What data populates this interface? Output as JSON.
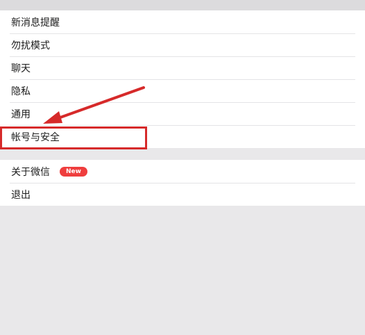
{
  "settings": {
    "group1": [
      {
        "label": "新消息提醒"
      },
      {
        "label": "勿扰模式"
      },
      {
        "label": "聊天"
      },
      {
        "label": "隐私"
      },
      {
        "label": "通用"
      },
      {
        "label": "帐号与安全"
      }
    ],
    "group2": [
      {
        "label": "关于微信",
        "badge": "New"
      },
      {
        "label": "退出"
      }
    ]
  },
  "colors": {
    "background": "#e9e8ea",
    "annotation": "#d62a2a",
    "badge": "#ef3e3e"
  }
}
